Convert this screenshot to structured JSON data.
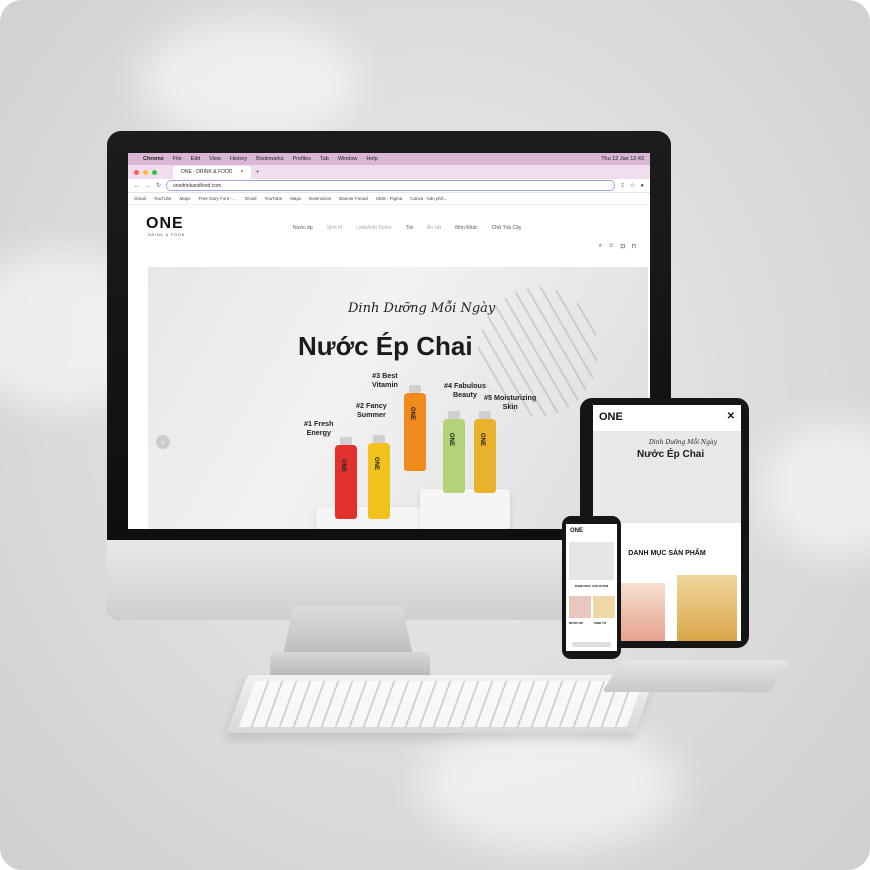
{
  "menubar": {
    "apple": "",
    "app": "Chrome",
    "items": [
      "File",
      "Edit",
      "View",
      "History",
      "Bookmarks",
      "Profiles",
      "Tab",
      "Window",
      "Help"
    ],
    "clock": "Thu 12 Jan 12:43"
  },
  "browser": {
    "tab_title": "ONE - DRINK & FOOD",
    "tab_close": "×",
    "new_tab": "+",
    "url": "onedrinkandfood.com",
    "bookmarks": [
      "Gmail",
      "YouTube",
      "Maps",
      "Free Gary Font - ...",
      "Gmail",
      "YouTube",
      "Maps",
      "Extensions",
      "Banner Foood",
      "UMS - Figma",
      "Canva - bản phố..."
    ]
  },
  "site": {
    "logo": "ONE",
    "logo_sub": "DRINK & FOOD",
    "nav": [
      {
        "label": "Nước ép",
        "dim": false
      },
      {
        "label": "Sinh tố",
        "dim": true
      },
      {
        "label": "Latte/Info Detox",
        "dim": true
      },
      {
        "label": "Trà",
        "dim": false
      },
      {
        "label": "Ăn vặt",
        "dim": true
      },
      {
        "label": "Món Khác",
        "dim": false
      },
      {
        "label": "Chữ Trái Cây",
        "dim": false
      }
    ],
    "icons": [
      "search-icon",
      "account-icon",
      "cart-icon",
      "bag-icon"
    ]
  },
  "hero": {
    "tagline": "Dinh Dưỡng Mỗi Ngày",
    "headline": "Nước Ép Chai",
    "labels": {
      "l1": "#1 Fresh\nEnergy",
      "l2": "#2 Fancy\nSummer",
      "l3": "#3 Best\nVitamin",
      "l4": "#4 Fabulous\nBeauty",
      "l5": "#5 Moisturizing\nSkin"
    },
    "bottle_mark": "ONE",
    "prev_arrow": "‹"
  },
  "tablet": {
    "logo": "ONE",
    "close": "✕",
    "tagline": "Dinh Dưỡng Mỗi Ngày",
    "headline": "Nước Ép Chai",
    "category_title": "DANH MỤC SẢN PHẨM"
  },
  "phone": {
    "logo": "ONE",
    "category_title": "DANH MỤC SẢN PHẨM",
    "item1": "NƯỚC ÉP",
    "item2": "SINH TỐ"
  },
  "colors": {
    "menubar": "#d9b6d4",
    "tabbar": "#f2ddee",
    "bottle_red": "#e2312c",
    "bottle_yellow": "#f1c21c",
    "bottle_orange": "#f08a1c",
    "bottle_green": "#b4d27a",
    "bottle_gold": "#e8b22a"
  }
}
